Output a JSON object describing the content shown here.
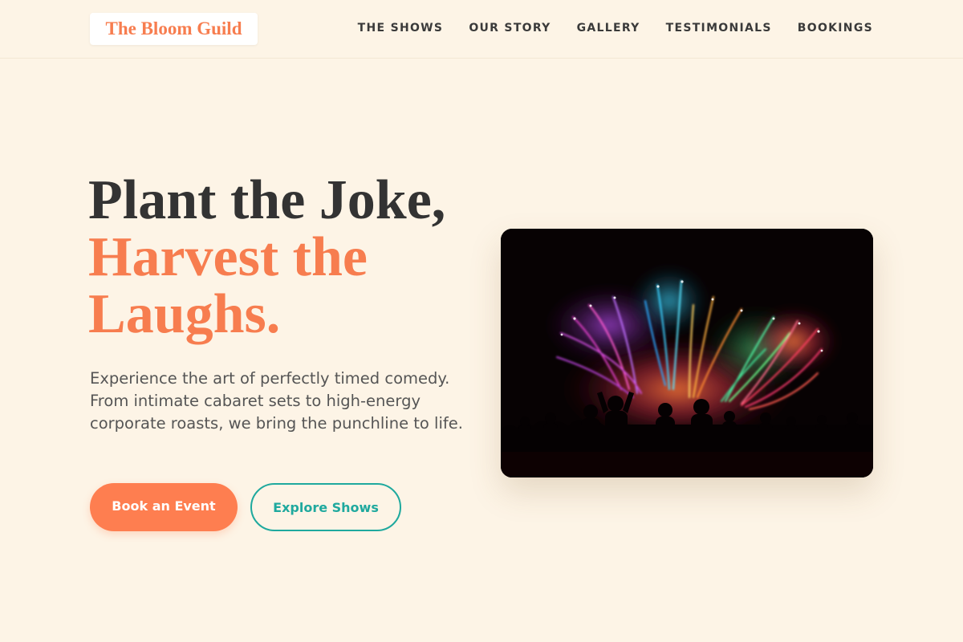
{
  "brand": {
    "name": "The Bloom Guild"
  },
  "nav": {
    "items": [
      {
        "label": "THE SHOWS"
      },
      {
        "label": "OUR STORY"
      },
      {
        "label": "GALLERY"
      },
      {
        "label": "TESTIMONIALS"
      },
      {
        "label": "BOOKINGS"
      }
    ]
  },
  "hero": {
    "title_line1": "Plant the Joke,",
    "title_line2": "Harvest the",
    "title_line3": "Laughs.",
    "subtitle": "Experience the art of perfectly timed comedy. From intimate cabaret sets to high-energy corporate roasts, we bring the punchline to life.",
    "image_icon": "fireworks-crowd-photo"
  },
  "buttons": {
    "primary_label": "Book an Event",
    "secondary_label": "Explore Shows"
  },
  "colors": {
    "background": "#fdf4e6",
    "accent": "#f77d4f",
    "teal": "#1fa99e",
    "heading": "#333333",
    "body": "#555555"
  }
}
